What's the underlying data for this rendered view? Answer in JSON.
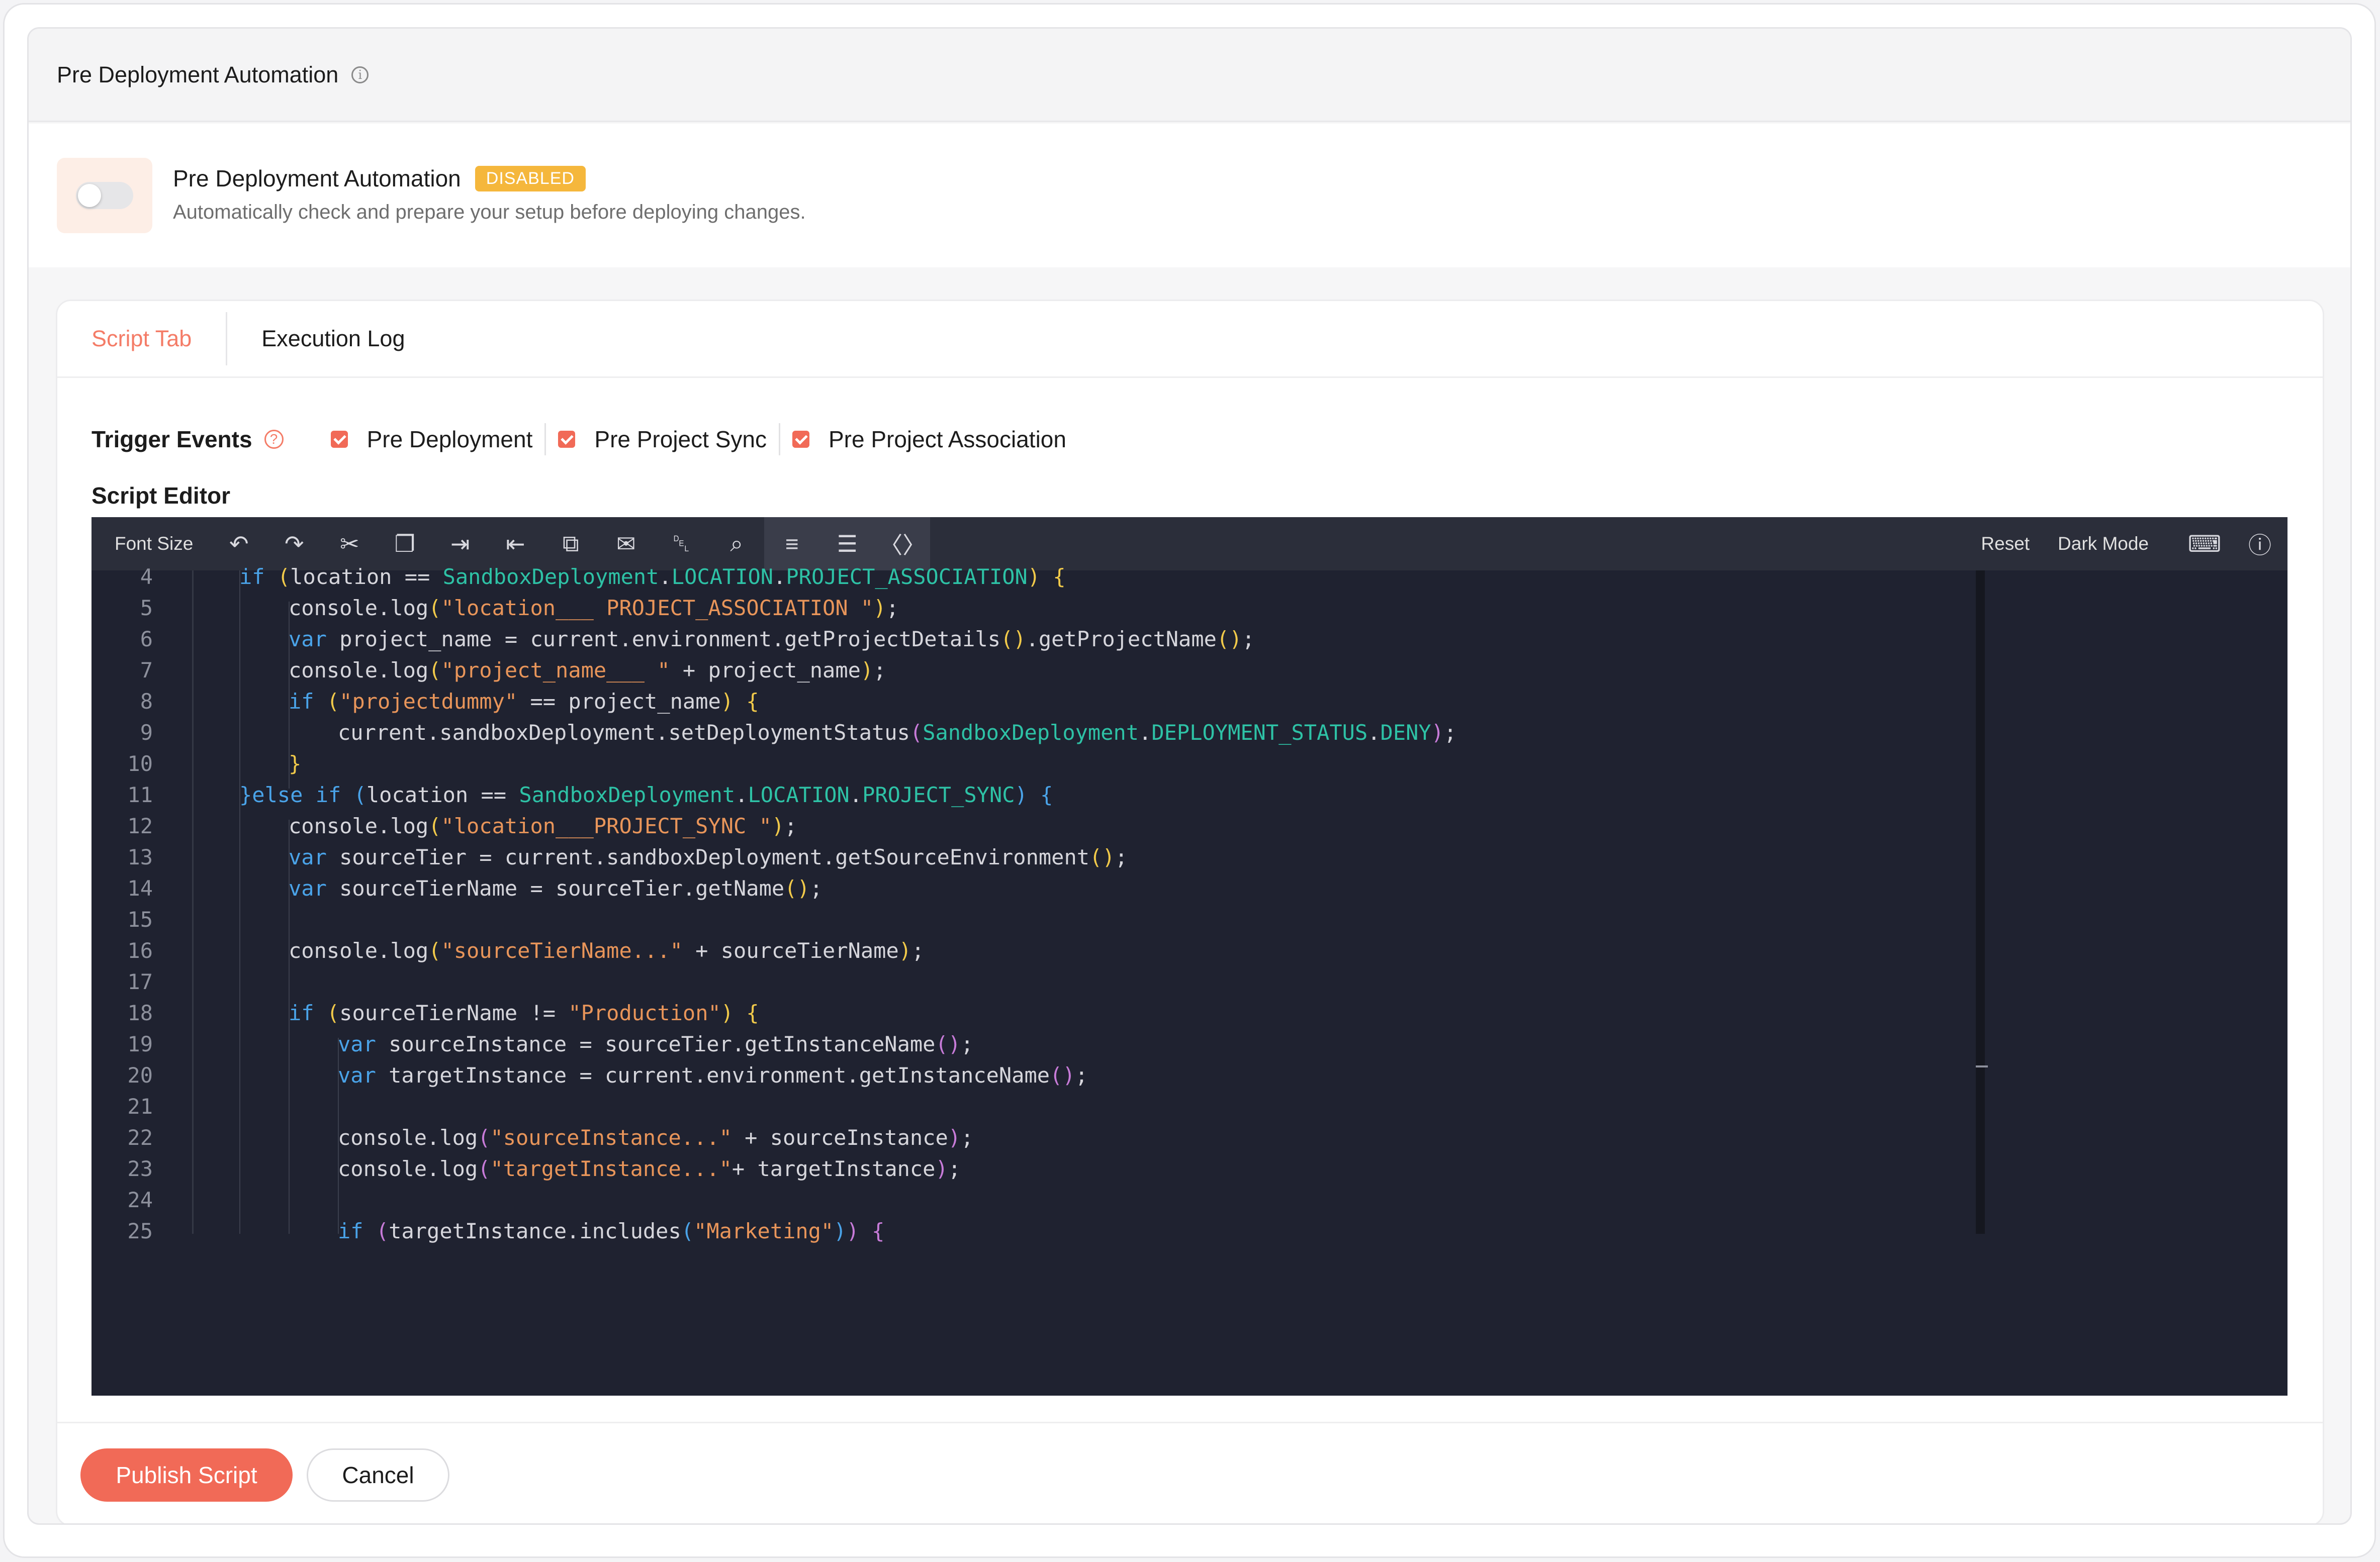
{
  "header": {
    "title": "Pre Deployment Automation"
  },
  "automation": {
    "title": "Pre Deployment Automation",
    "status_badge": "DISABLED",
    "description": "Automatically check and prepare your setup before deploying changes.",
    "toggle_enabled": false
  },
  "tabs": [
    {
      "label": "Script Tab",
      "active": true
    },
    {
      "label": "Execution Log",
      "active": false
    }
  ],
  "triggers": {
    "label": "Trigger Events",
    "items": [
      {
        "label": "Pre Deployment",
        "checked": true
      },
      {
        "label": "Pre Project Sync",
        "checked": true
      },
      {
        "label": "Pre Project Association",
        "checked": true
      }
    ]
  },
  "editor": {
    "label": "Script Editor",
    "toolbar": {
      "font_size": "Font Size",
      "reset": "Reset",
      "dark_mode": "Dark Mode",
      "icons": [
        "undo-icon",
        "redo-icon",
        "cut-icon",
        "copy-icon",
        "indent-icon",
        "outdent-icon",
        "duplicate-icon",
        "comment-icon",
        "delete-icon",
        "search-replace-icon",
        "format-icon",
        "line-numbers-icon",
        "wrap-icon"
      ]
    },
    "lines": [
      {
        "n": "4",
        "text": "if (location == SandboxDeployment.LOCATION.PROJECT_ASSOCIATION) {"
      },
      {
        "n": "5",
        "text": "console.log(\"location___ PROJECT_ASSOCIATION \");"
      },
      {
        "n": "6",
        "text": "var project_name = current.environment.getProjectDetails().getProjectName();"
      },
      {
        "n": "7",
        "text": "console.log(\"project_name___ \" + project_name);"
      },
      {
        "n": "8",
        "text": "if (\"projectdummy\" == project_name) {"
      },
      {
        "n": "9",
        "text": "current.sandboxDeployment.setDeploymentStatus(SandboxDeployment.DEPLOYMENT_STATUS.DENY);"
      },
      {
        "n": "10",
        "text": "}"
      },
      {
        "n": "11",
        "text": "}else if (location == SandboxDeployment.LOCATION.PROJECT_SYNC) {"
      },
      {
        "n": "12",
        "text": "console.log(\"location___PROJECT_SYNC \");"
      },
      {
        "n": "13",
        "text": "var sourceTier = current.sandboxDeployment.getSourceEnvironment();"
      },
      {
        "n": "14",
        "text": "var sourceTierName = sourceTier.getName();"
      },
      {
        "n": "15",
        "text": ""
      },
      {
        "n": "16",
        "text": "console.log(\"sourceTierName...\" + sourceTierName);"
      },
      {
        "n": "17",
        "text": ""
      },
      {
        "n": "18",
        "text": "if (sourceTierName != \"Production\") {"
      },
      {
        "n": "19",
        "text": "var sourceInstance = sourceTier.getInstanceName();"
      },
      {
        "n": "20",
        "text": "var targetInstance = current.environment.getInstanceName();"
      },
      {
        "n": "21",
        "text": ""
      },
      {
        "n": "22",
        "text": "console.log(\"sourceInstance...\" + sourceInstance);"
      },
      {
        "n": "23",
        "text": "console.log(\"targetInstance...\"+ targetInstance);"
      },
      {
        "n": "24",
        "text": ""
      },
      {
        "n": "25",
        "text": "if (targetInstance.includes(\"Marketing\")) {"
      }
    ]
  },
  "footer": {
    "publish_label": "Publish Script",
    "cancel_label": "Cancel"
  },
  "colors": {
    "accent": "#f16a57",
    "badge": "#f5b73c",
    "editor_bg": "#1f2230",
    "keyword": "#4aa3e8",
    "string": "#e8955a",
    "constant": "#2ec2a6"
  }
}
